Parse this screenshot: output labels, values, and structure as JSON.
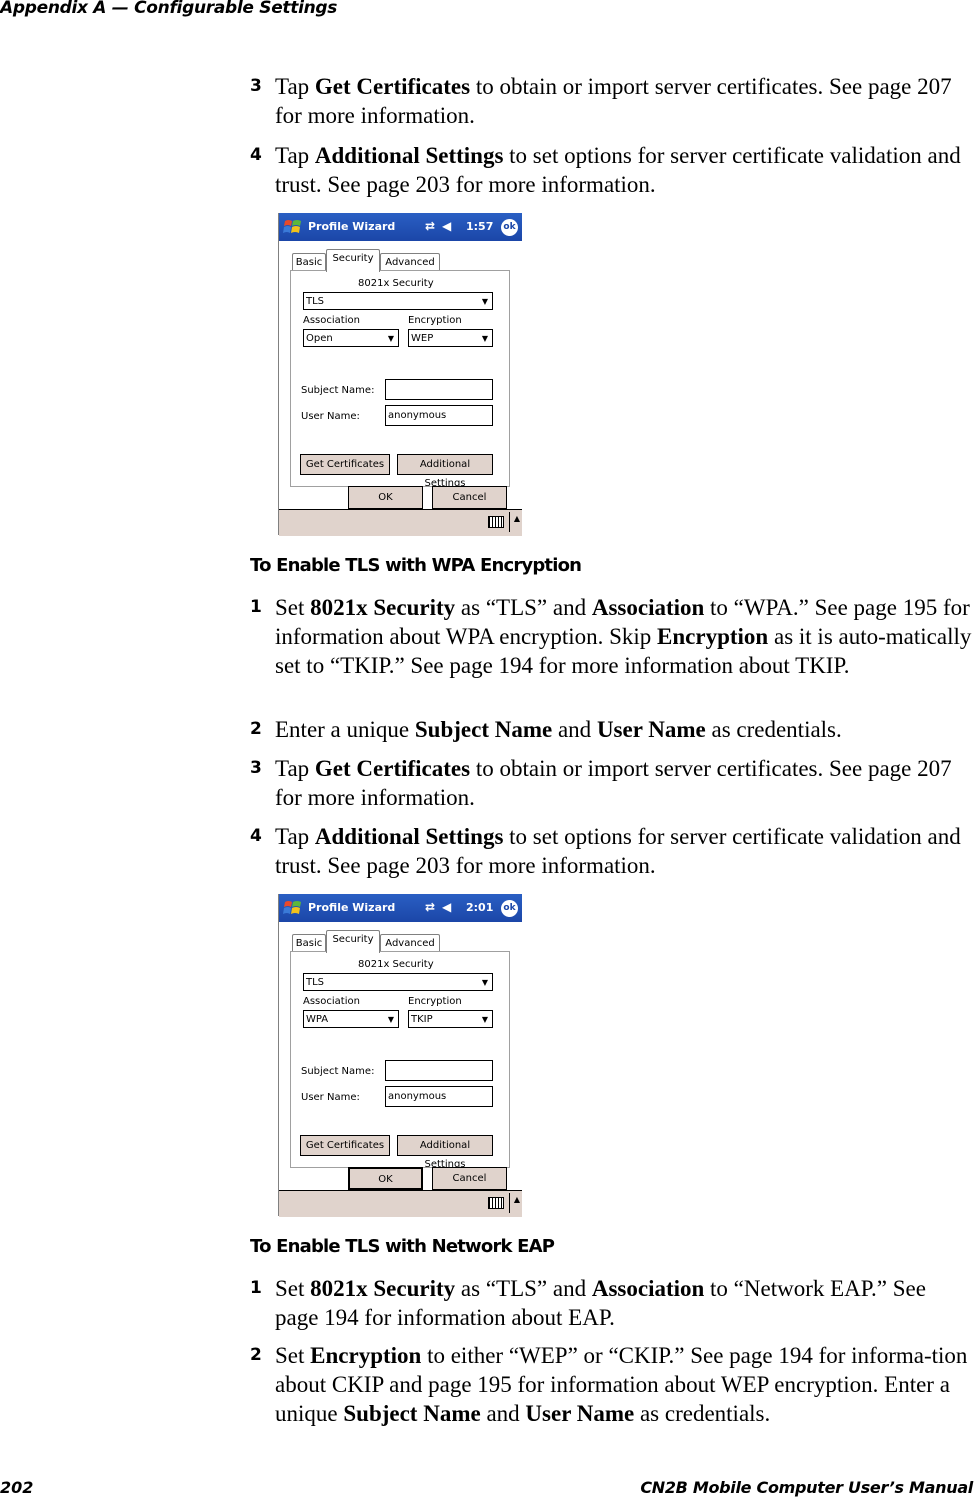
{
  "page_header": "Appendix A — Configurable Settings",
  "footer": {
    "page_number": "202",
    "manual_title": "CN2B Mobile Computer User’s Manual"
  },
  "block1": {
    "steps": [
      {
        "num": "3",
        "pre": "Tap ",
        "b1": "Get Certificates",
        "post": " to obtain or import server certificates. See page 207 for more information."
      },
      {
        "num": "4",
        "pre": "Tap ",
        "b1": "Additional Settings",
        "post": " to set options for server certificate validation and trust. See page 203 for more information."
      }
    ]
  },
  "screens": [
    {
      "title": "Profile Wizard",
      "time": "1:57",
      "ok": "ok",
      "tabs": [
        "Basic",
        "Security",
        "Advanced"
      ],
      "active_tab": "Security",
      "security_label": "8021x Security",
      "security_value": "TLS",
      "association_label": "Association",
      "association_value": "Open",
      "encryption_label": "Encryption",
      "encryption_value": "WEP",
      "subject_label": "Subject Name:",
      "subject_value": "",
      "user_label": "User Name:",
      "user_value": "anonymous",
      "get_certs": "Get Certificates",
      "additional": "Additional Settings",
      "ok_btn": "OK",
      "cancel_btn": "Cancel"
    },
    {
      "title": "Profile Wizard",
      "time": "2:01",
      "ok": "ok",
      "tabs": [
        "Basic",
        "Security",
        "Advanced"
      ],
      "active_tab": "Security",
      "security_label": "8021x Security",
      "security_value": "TLS",
      "association_label": "Association",
      "association_value": "WPA",
      "encryption_label": "Encryption",
      "encryption_value": "TKIP",
      "subject_label": "Subject Name:",
      "subject_value": "",
      "user_label": "User Name:",
      "user_value": "anonymous",
      "get_certs": "Get Certificates",
      "additional": "Additional Settings",
      "ok_btn": "OK",
      "cancel_btn": "Cancel"
    }
  ],
  "section_wpa": {
    "heading": "To Enable TLS with WPA Encryption",
    "step1": {
      "num": "1",
      "t1": "Set ",
      "b1": "8021x Security",
      "t2": " as “TLS” and ",
      "b2": "Association",
      "t3": " to “WPA.” See page 195 for information about WPA encryption. Skip ",
      "b3": "Encryption",
      "t4": " as it is auto-matically set to “TKIP.” See page 194 for more information about TKIP."
    },
    "step2": {
      "num": "2",
      "t1": "Enter a unique ",
      "b1": "Subject Name",
      "t2": " and ",
      "b2": "User Name",
      "t3": " as credentials."
    },
    "step3": {
      "num": "3",
      "pre": "Tap ",
      "b1": "Get Certificates",
      "post": " to obtain or import server certificates. See page 207 for more information."
    },
    "step4": {
      "num": "4",
      "pre": "Tap ",
      "b1": "Additional Settings",
      "post": " to set options for server certificate validation and trust. See page 203 for more information."
    }
  },
  "section_eap": {
    "heading": "To Enable TLS with Network EAP",
    "step1": {
      "num": "1",
      "t1": "Set ",
      "b1": "8021x Security",
      "t2": " as “TLS” and ",
      "b2": "Association",
      "t3": " to “Network EAP.” See page 194 for information about EAP."
    },
    "step2": {
      "num": "2",
      "t1": "Set ",
      "b1": "Encryption",
      "t2": " to either “WEP” or “CKIP.” See page 194 for informa-tion about CKIP and page 195 for information about WEP encryption. Enter a unique ",
      "b2": "Subject Name",
      "t3": " and ",
      "b3": "User Name",
      "t4": " as credentials."
    }
  }
}
